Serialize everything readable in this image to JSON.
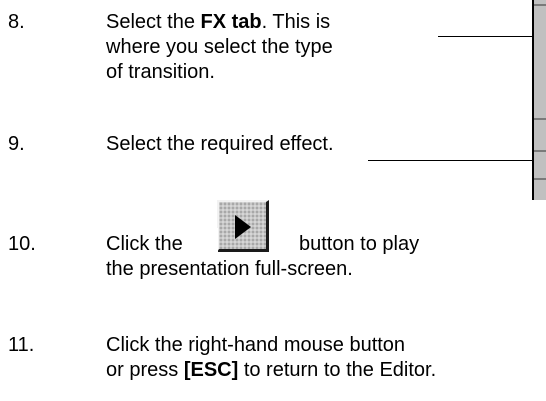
{
  "steps": [
    {
      "number": "8.",
      "pre": "Select the ",
      "bold": "FX tab",
      "post": ". This is",
      "line2": "where you select the type",
      "line3": "of transition."
    },
    {
      "number": "9.",
      "text": "Select the required effect."
    },
    {
      "number": "10.",
      "pre": "Click the",
      "post": "button to play",
      "line2": "the presentation full-screen."
    },
    {
      "number": "11.",
      "line1": "Click the right-hand mouse button",
      "pre": "or press ",
      "bold": "[ESC]",
      "post": " to return to the Editor."
    }
  ],
  "icons": {
    "play_button": "play-triangle-icon"
  }
}
